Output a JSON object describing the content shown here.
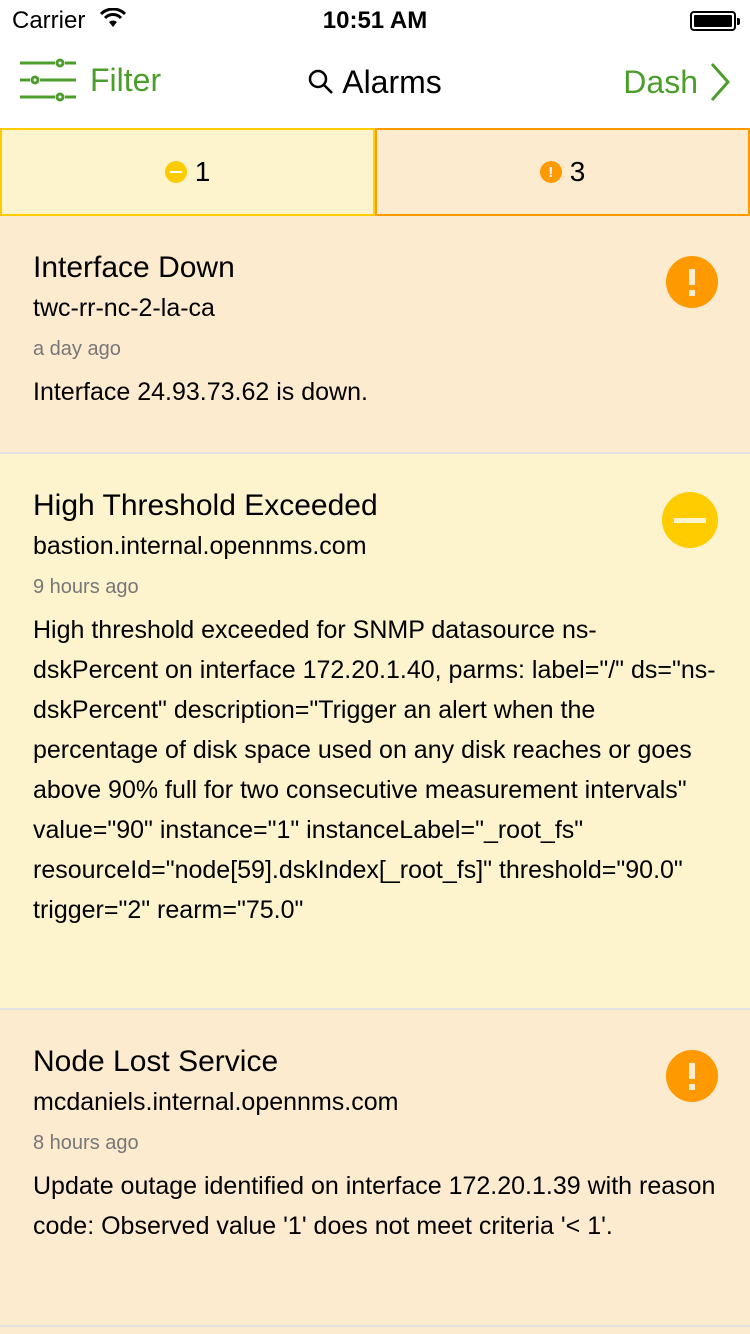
{
  "status_bar": {
    "carrier": "Carrier",
    "time": "10:51 AM"
  },
  "nav": {
    "filter_label": "Filter",
    "title": "Alarms",
    "dash_label": "Dash"
  },
  "tabs": [
    {
      "severity": "minor",
      "count": "1",
      "color": "#ffcc00"
    },
    {
      "severity": "major",
      "count": "3",
      "color": "#ff9900"
    }
  ],
  "colors": {
    "accent": "#4c9e2c",
    "major": "#ff9900",
    "minor": "#ffcc00",
    "major_bg": "#fdebd0",
    "minor_bg": "#fdf4ce"
  },
  "alarms": [
    {
      "severity": "major",
      "title": "Interface Down",
      "host": "twc-rr-nc-2-la-ca",
      "time": "a day ago",
      "description": "Interface 24.93.73.62 is down.",
      "icon": "exclamation-circle-icon"
    },
    {
      "severity": "minor",
      "title": "High Threshold Exceeded",
      "host": "bastion.internal.opennms.com",
      "time": "9 hours ago",
      "description": "High threshold exceeded for SNMP datasource ns-dskPercent on interface 172.20.1.40, parms: label=\"/\" ds=\"ns-dskPercent\" description=\"Trigger an alert when the percentage of disk space used on any disk reaches or goes above 90% full for two consecutive measurement intervals\" value=\"90\" instance=\"1\" instanceLabel=\"_root_fs\" resourceId=\"node[59].dskIndex[_root_fs]\" threshold=\"90.0\" trigger=\"2\" rearm=\"75.0\"",
      "icon": "minus-circle-icon"
    },
    {
      "severity": "major",
      "title": "Node Lost Service",
      "host": "mcdaniels.internal.opennms.com",
      "time": "8 hours ago",
      "description": "Update outage identified on interface 172.20.1.39 with reason code: Observed value '1' does not meet criteria '< 1'.",
      "icon": "exclamation-circle-icon"
    }
  ]
}
